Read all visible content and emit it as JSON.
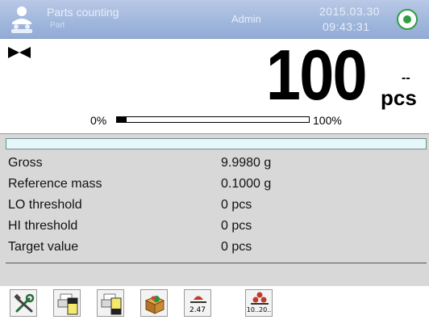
{
  "header": {
    "mode_title": "Parts counting",
    "mode_subtitle": "Part",
    "user_level": "Admin",
    "date": "2015.03.30",
    "time": "09:43:31"
  },
  "display": {
    "value": "100",
    "unit_marker": "--",
    "unit": "pcs",
    "bar_min_label": "0%",
    "bar_max_label": "100%",
    "bar_fill_fraction": 0.05
  },
  "info": {
    "rows": [
      {
        "label": "Gross",
        "value": "9.9980 g"
      },
      {
        "label": "Reference mass",
        "value": "0.1000 g"
      },
      {
        "label": "LO threshold",
        "value": "0 pcs"
      },
      {
        "label": "HI threshold",
        "value": "0 pcs"
      },
      {
        "label": "Target value",
        "value": "0 pcs"
      }
    ]
  },
  "toolbar": {
    "buttons": [
      {
        "icon": "settings-tools-icon"
      },
      {
        "icon": "printout-header-icon"
      },
      {
        "icon": "printout-footer-icon"
      },
      {
        "icon": "database-icon"
      },
      {
        "icon": "reference-mass-icon",
        "text": "2.47"
      },
      {
        "icon": "quantity-icon",
        "text": "10..20.."
      }
    ]
  },
  "colors": {
    "header": "#9fb6dc",
    "stable": "#2f9e44",
    "info_panel": "#d8d8d8",
    "info_strip": "#e6f7f9"
  }
}
